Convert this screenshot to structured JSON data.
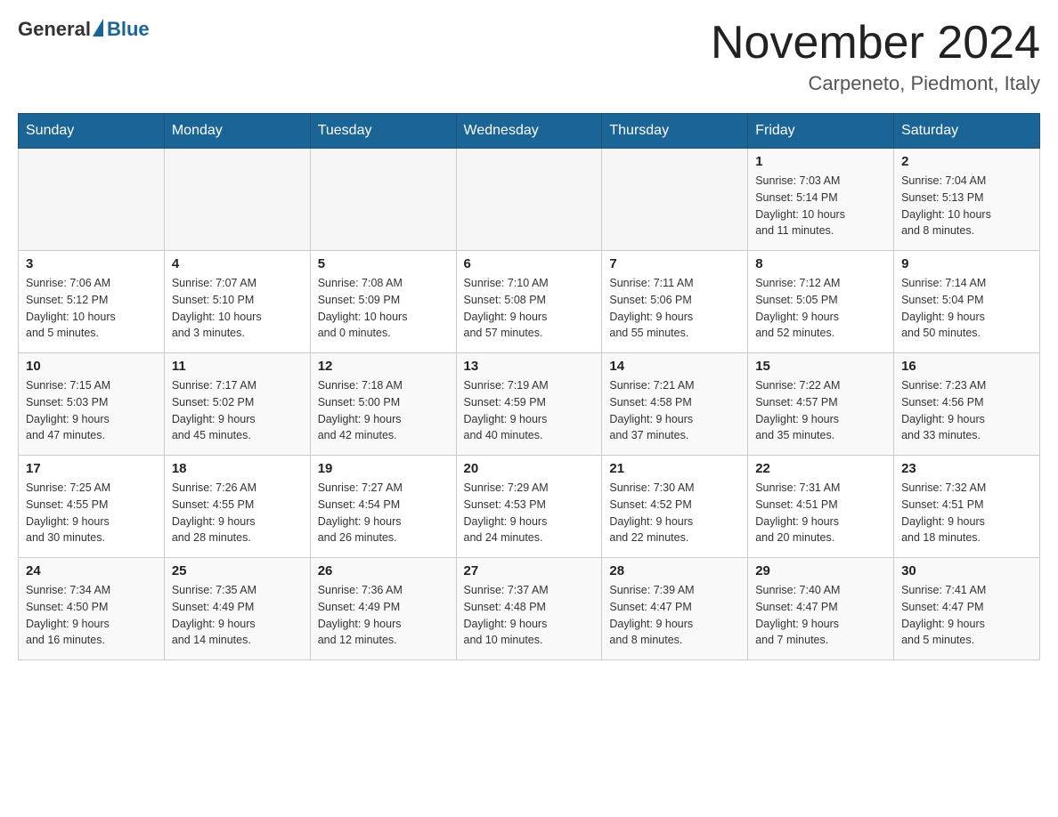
{
  "header": {
    "logo": {
      "general": "General",
      "blue": "Blue"
    },
    "title": "November 2024",
    "location": "Carpeneto, Piedmont, Italy"
  },
  "weekdays": [
    "Sunday",
    "Monday",
    "Tuesday",
    "Wednesday",
    "Thursday",
    "Friday",
    "Saturday"
  ],
  "weeks": [
    {
      "days": [
        {
          "num": "",
          "info": ""
        },
        {
          "num": "",
          "info": ""
        },
        {
          "num": "",
          "info": ""
        },
        {
          "num": "",
          "info": ""
        },
        {
          "num": "",
          "info": ""
        },
        {
          "num": "1",
          "info": "Sunrise: 7:03 AM\nSunset: 5:14 PM\nDaylight: 10 hours\nand 11 minutes."
        },
        {
          "num": "2",
          "info": "Sunrise: 7:04 AM\nSunset: 5:13 PM\nDaylight: 10 hours\nand 8 minutes."
        }
      ]
    },
    {
      "days": [
        {
          "num": "3",
          "info": "Sunrise: 7:06 AM\nSunset: 5:12 PM\nDaylight: 10 hours\nand 5 minutes."
        },
        {
          "num": "4",
          "info": "Sunrise: 7:07 AM\nSunset: 5:10 PM\nDaylight: 10 hours\nand 3 minutes."
        },
        {
          "num": "5",
          "info": "Sunrise: 7:08 AM\nSunset: 5:09 PM\nDaylight: 10 hours\nand 0 minutes."
        },
        {
          "num": "6",
          "info": "Sunrise: 7:10 AM\nSunset: 5:08 PM\nDaylight: 9 hours\nand 57 minutes."
        },
        {
          "num": "7",
          "info": "Sunrise: 7:11 AM\nSunset: 5:06 PM\nDaylight: 9 hours\nand 55 minutes."
        },
        {
          "num": "8",
          "info": "Sunrise: 7:12 AM\nSunset: 5:05 PM\nDaylight: 9 hours\nand 52 minutes."
        },
        {
          "num": "9",
          "info": "Sunrise: 7:14 AM\nSunset: 5:04 PM\nDaylight: 9 hours\nand 50 minutes."
        }
      ]
    },
    {
      "days": [
        {
          "num": "10",
          "info": "Sunrise: 7:15 AM\nSunset: 5:03 PM\nDaylight: 9 hours\nand 47 minutes."
        },
        {
          "num": "11",
          "info": "Sunrise: 7:17 AM\nSunset: 5:02 PM\nDaylight: 9 hours\nand 45 minutes."
        },
        {
          "num": "12",
          "info": "Sunrise: 7:18 AM\nSunset: 5:00 PM\nDaylight: 9 hours\nand 42 minutes."
        },
        {
          "num": "13",
          "info": "Sunrise: 7:19 AM\nSunset: 4:59 PM\nDaylight: 9 hours\nand 40 minutes."
        },
        {
          "num": "14",
          "info": "Sunrise: 7:21 AM\nSunset: 4:58 PM\nDaylight: 9 hours\nand 37 minutes."
        },
        {
          "num": "15",
          "info": "Sunrise: 7:22 AM\nSunset: 4:57 PM\nDaylight: 9 hours\nand 35 minutes."
        },
        {
          "num": "16",
          "info": "Sunrise: 7:23 AM\nSunset: 4:56 PM\nDaylight: 9 hours\nand 33 minutes."
        }
      ]
    },
    {
      "days": [
        {
          "num": "17",
          "info": "Sunrise: 7:25 AM\nSunset: 4:55 PM\nDaylight: 9 hours\nand 30 minutes."
        },
        {
          "num": "18",
          "info": "Sunrise: 7:26 AM\nSunset: 4:55 PM\nDaylight: 9 hours\nand 28 minutes."
        },
        {
          "num": "19",
          "info": "Sunrise: 7:27 AM\nSunset: 4:54 PM\nDaylight: 9 hours\nand 26 minutes."
        },
        {
          "num": "20",
          "info": "Sunrise: 7:29 AM\nSunset: 4:53 PM\nDaylight: 9 hours\nand 24 minutes."
        },
        {
          "num": "21",
          "info": "Sunrise: 7:30 AM\nSunset: 4:52 PM\nDaylight: 9 hours\nand 22 minutes."
        },
        {
          "num": "22",
          "info": "Sunrise: 7:31 AM\nSunset: 4:51 PM\nDaylight: 9 hours\nand 20 minutes."
        },
        {
          "num": "23",
          "info": "Sunrise: 7:32 AM\nSunset: 4:51 PM\nDaylight: 9 hours\nand 18 minutes."
        }
      ]
    },
    {
      "days": [
        {
          "num": "24",
          "info": "Sunrise: 7:34 AM\nSunset: 4:50 PM\nDaylight: 9 hours\nand 16 minutes."
        },
        {
          "num": "25",
          "info": "Sunrise: 7:35 AM\nSunset: 4:49 PM\nDaylight: 9 hours\nand 14 minutes."
        },
        {
          "num": "26",
          "info": "Sunrise: 7:36 AM\nSunset: 4:49 PM\nDaylight: 9 hours\nand 12 minutes."
        },
        {
          "num": "27",
          "info": "Sunrise: 7:37 AM\nSunset: 4:48 PM\nDaylight: 9 hours\nand 10 minutes."
        },
        {
          "num": "28",
          "info": "Sunrise: 7:39 AM\nSunset: 4:47 PM\nDaylight: 9 hours\nand 8 minutes."
        },
        {
          "num": "29",
          "info": "Sunrise: 7:40 AM\nSunset: 4:47 PM\nDaylight: 9 hours\nand 7 minutes."
        },
        {
          "num": "30",
          "info": "Sunrise: 7:41 AM\nSunset: 4:47 PM\nDaylight: 9 hours\nand 5 minutes."
        }
      ]
    }
  ]
}
